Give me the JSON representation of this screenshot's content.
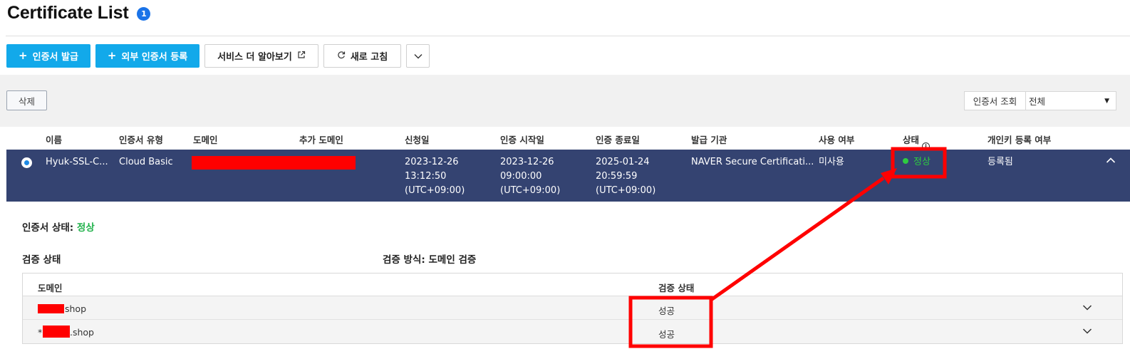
{
  "page": {
    "title": "Certificate List",
    "count": "1"
  },
  "toolbar": {
    "issue": "인증서 발급",
    "register_external": "외부 인증서 등록",
    "learn_more": "서비스 더 알아보기",
    "refresh": "새로 고침"
  },
  "filter": {
    "delete": "삭제",
    "label": "인증서 조회",
    "value": "전체"
  },
  "table": {
    "headers": [
      "이름",
      "인증서 유형",
      "도메인",
      "추가 도메인",
      "신청일",
      "인증 시작일",
      "인증 종료일",
      "발급 기관",
      "사용 여부",
      "상태",
      "개인키 등록 여부"
    ],
    "row": {
      "name": "Hyuk-SSL-C...",
      "type": "Cloud Basic",
      "request_date": "2023-12-26",
      "request_time": "13:12:50",
      "request_tz": "(UTC+09:00)",
      "start_date": "2023-12-26",
      "start_time": "09:00:00",
      "start_tz": "(UTC+09:00)",
      "end_date": "2025-01-24",
      "end_time": "20:59:59",
      "end_tz": "(UTC+09:00)",
      "issuer": "NAVER Secure Certificati...",
      "usage": "미사용",
      "status": "정상",
      "private_key": "등록됨"
    }
  },
  "detail": {
    "status_label": "인증서 상태:",
    "status_value": "정상",
    "verify_title": "검증 상태",
    "verify_method": "검증 방식: 도메인 검증",
    "sub_headers": [
      "도메인",
      "검증 상태"
    ],
    "rows": [
      {
        "prefix": "",
        "domain_suffix": "shop",
        "status": "성공"
      },
      {
        "prefix": "*",
        "domain_suffix": ".shop",
        "status": "성공"
      }
    ]
  },
  "colors": {
    "primary": "#12a9ea",
    "selected_row": "#344371",
    "success": "#2ecc40",
    "annotation": "#ff0000"
  }
}
